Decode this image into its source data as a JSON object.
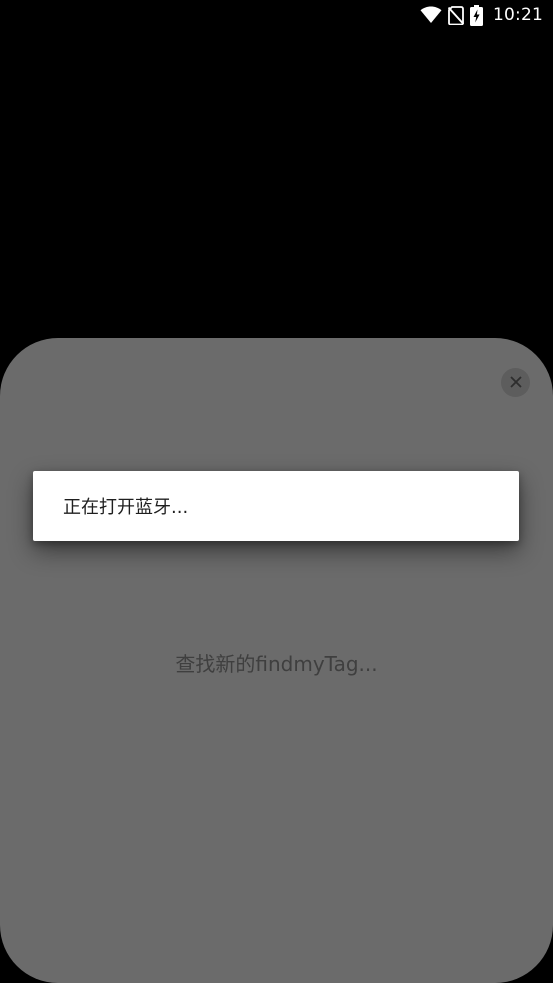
{
  "status_bar": {
    "time": "10:21",
    "icons": [
      "wifi-icon",
      "no-sim-icon",
      "battery-charging-icon"
    ]
  },
  "sheet": {
    "close_icon": "close-icon",
    "searching_text": "查找新的findmyTag..."
  },
  "dialog": {
    "message": "正在打开蓝牙..."
  },
  "colors": {
    "background": "#000000",
    "sheet": "#6b6b6b",
    "close_button": "#5d5d5d",
    "dialog": "#ffffff",
    "dialog_text": "#1f1f1f",
    "searching_text": "#3f3f3f"
  }
}
